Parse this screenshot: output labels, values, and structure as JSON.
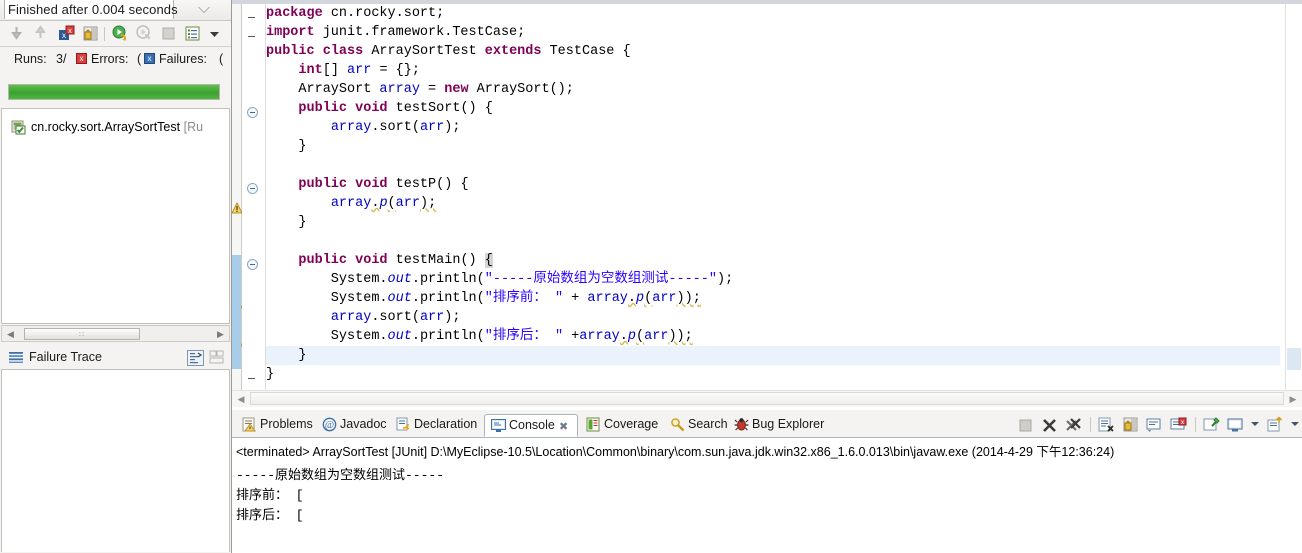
{
  "junit": {
    "title": "Finished after 0.004 seconds",
    "view_menu_icon": "chevron-down-icon",
    "toolbar": [
      {
        "name": "next-failure-icon",
        "glyph": "⇩"
      },
      {
        "name": "previous-failure-icon",
        "glyph": "⇧"
      },
      {
        "name": "show-failures-only-icon",
        "glyph": "x"
      },
      {
        "name": "scroll-lock-icon",
        "glyph": "ὑ2"
      },
      {
        "name": "rerun-test-icon",
        "glyph": "▶"
      },
      {
        "name": "rerun-test-failures-icon",
        "glyph": "▷"
      },
      {
        "name": "stop-test-run-icon",
        "glyph": "■"
      },
      {
        "name": "test-run-history-icon",
        "glyph": "☰"
      },
      {
        "name": "view-menu-icon",
        "glyph": "▾"
      }
    ],
    "stats": {
      "runs_label": "Runs:",
      "runs_value": "3/",
      "errors_label": "Errors:",
      "errors_value": "(",
      "failures_label": "Failures:",
      "failures_value": "("
    },
    "progress": {
      "percent": 100,
      "color": "#3da12f"
    },
    "tree": {
      "items": [
        {
          "icon": "test-class-passed-icon",
          "label": "cn.rocky.sort.ArraySortTest",
          "suffix": "[Ru"
        }
      ]
    },
    "hscroll": {
      "left_arrow": "◀",
      "right_arrow": "▶",
      "thumb_grip": "∶∶"
    },
    "failure_trace": {
      "icon": "failure-trace-icon",
      "label": "Failure Trace",
      "buttons": [
        {
          "name": "compare-result-icon"
        },
        {
          "name": "failure-trace-view-menu-icon"
        }
      ]
    }
  },
  "editor": {
    "code_lines": [
      {
        "fold": null,
        "dash": true,
        "warn": false,
        "changed": false,
        "current": false,
        "tokens": [
          {
            "t": "package",
            "c": "k"
          },
          {
            "t": " cn.rocky.sort;",
            "c": "m"
          }
        ]
      },
      {
        "fold": null,
        "dash": true,
        "warn": false,
        "changed": false,
        "current": false,
        "tokens": [
          {
            "t": "import",
            "c": "k"
          },
          {
            "t": " junit.framework.TestCase;",
            "c": "m"
          }
        ]
      },
      {
        "fold": null,
        "dash": false,
        "warn": false,
        "changed": false,
        "current": false,
        "tokens": [
          {
            "t": "public",
            "c": "k"
          },
          {
            "t": " ",
            "c": "m"
          },
          {
            "t": "class",
            "c": "k"
          },
          {
            "t": " ArraySortTest ",
            "c": "m"
          },
          {
            "t": "extends",
            "c": "k"
          },
          {
            "t": " TestCase {",
            "c": "m"
          }
        ]
      },
      {
        "fold": null,
        "dash": false,
        "warn": false,
        "changed": false,
        "current": false,
        "tokens": [
          {
            "t": "    ",
            "c": "m"
          },
          {
            "t": "int",
            "c": "k"
          },
          {
            "t": "[] ",
            "c": "m"
          },
          {
            "t": "arr",
            "c": "f"
          },
          {
            "t": " = {};",
            "c": "m"
          }
        ]
      },
      {
        "fold": null,
        "dash": false,
        "warn": false,
        "changed": false,
        "current": false,
        "tokens": [
          {
            "t": "    ArraySort ",
            "c": "m"
          },
          {
            "t": "array",
            "c": "f"
          },
          {
            "t": " = ",
            "c": "m"
          },
          {
            "t": "new",
            "c": "k"
          },
          {
            "t": " ArraySort();",
            "c": "m"
          }
        ]
      },
      {
        "fold": "collapse",
        "dash": false,
        "warn": false,
        "changed": false,
        "current": false,
        "tokens": [
          {
            "t": "    ",
            "c": "m"
          },
          {
            "t": "public",
            "c": "k"
          },
          {
            "t": " ",
            "c": "m"
          },
          {
            "t": "void",
            "c": "k"
          },
          {
            "t": " testSort() {",
            "c": "m"
          }
        ]
      },
      {
        "fold": null,
        "dash": false,
        "warn": false,
        "changed": false,
        "current": false,
        "tokens": [
          {
            "t": "        ",
            "c": "m"
          },
          {
            "t": "array",
            "c": "f"
          },
          {
            "t": ".sort(",
            "c": "m"
          },
          {
            "t": "arr",
            "c": "f"
          },
          {
            "t": ");",
            "c": "m"
          }
        ]
      },
      {
        "fold": null,
        "dash": false,
        "warn": false,
        "changed": false,
        "current": false,
        "tokens": [
          {
            "t": "    }",
            "c": "m"
          }
        ]
      },
      {
        "fold": null,
        "dash": false,
        "warn": false,
        "changed": false,
        "current": false,
        "tokens": []
      },
      {
        "fold": "collapse",
        "dash": false,
        "warn": false,
        "changed": false,
        "current": false,
        "tokens": [
          {
            "t": "    ",
            "c": "m"
          },
          {
            "t": "public",
            "c": "k"
          },
          {
            "t": " ",
            "c": "m"
          },
          {
            "t": "void",
            "c": "k"
          },
          {
            "t": " testP() {",
            "c": "m"
          }
        ]
      },
      {
        "fold": null,
        "dash": false,
        "warn": true,
        "changed": false,
        "current": false,
        "tokens": [
          {
            "t": "        ",
            "c": "m"
          },
          {
            "t": "array",
            "c": "f"
          },
          {
            "t": ".",
            "c": "mu"
          },
          {
            "t": "p",
            "c": "fi"
          },
          {
            "t": "(",
            "c": "mu"
          },
          {
            "t": "arr",
            "c": "f"
          },
          {
            "t": ");",
            "c": "mu"
          }
        ]
      },
      {
        "fold": null,
        "dash": false,
        "warn": false,
        "changed": false,
        "current": false,
        "tokens": [
          {
            "t": "    }",
            "c": "m"
          }
        ]
      },
      {
        "fold": null,
        "dash": false,
        "warn": false,
        "changed": false,
        "current": false,
        "tokens": []
      },
      {
        "fold": "collapse",
        "dash": false,
        "warn": false,
        "changed": true,
        "current": false,
        "tokens": [
          {
            "t": "    ",
            "c": "m"
          },
          {
            "t": "public",
            "c": "k"
          },
          {
            "t": " ",
            "c": "m"
          },
          {
            "t": "void",
            "c": "k"
          },
          {
            "t": " testMain() ",
            "c": "m"
          },
          {
            "t": "{",
            "c": "sel-brace"
          }
        ]
      },
      {
        "fold": null,
        "dash": false,
        "warn": false,
        "changed": true,
        "current": false,
        "tokens": [
          {
            "t": "        System.",
            "c": "m"
          },
          {
            "t": "out",
            "c": "fi"
          },
          {
            "t": ".println(",
            "c": "m"
          },
          {
            "t": "\"-----原始数组为空数组测试-----\"",
            "c": "s"
          },
          {
            "t": ");",
            "c": "m"
          }
        ]
      },
      {
        "fold": null,
        "dash": false,
        "warn": true,
        "changed": true,
        "current": false,
        "tokens": [
          {
            "t": "        System.",
            "c": "m"
          },
          {
            "t": "out",
            "c": "fi"
          },
          {
            "t": ".println(",
            "c": "m"
          },
          {
            "t": "\"排序前： \"",
            "c": "s"
          },
          {
            "t": " + ",
            "c": "m"
          },
          {
            "t": "array",
            "c": "f"
          },
          {
            "t": ".",
            "c": "mu"
          },
          {
            "t": "p",
            "c": "fi"
          },
          {
            "t": "(",
            "c": "mu"
          },
          {
            "t": "arr",
            "c": "f"
          },
          {
            "t": "));",
            "c": "mu"
          }
        ]
      },
      {
        "fold": null,
        "dash": false,
        "warn": false,
        "changed": true,
        "current": false,
        "tokens": [
          {
            "t": "        ",
            "c": "m"
          },
          {
            "t": "array",
            "c": "f"
          },
          {
            "t": ".sort(",
            "c": "m"
          },
          {
            "t": "arr",
            "c": "f"
          },
          {
            "t": ");",
            "c": "m"
          }
        ]
      },
      {
        "fold": null,
        "dash": false,
        "warn": true,
        "changed": true,
        "current": false,
        "tokens": [
          {
            "t": "        System.",
            "c": "m"
          },
          {
            "t": "out",
            "c": "fi"
          },
          {
            "t": ".println(",
            "c": "m"
          },
          {
            "t": "\"排序后： \"",
            "c": "s"
          },
          {
            "t": " +",
            "c": "m"
          },
          {
            "t": "array",
            "c": "f"
          },
          {
            "t": ".",
            "c": "mu"
          },
          {
            "t": "p",
            "c": "fi"
          },
          {
            "t": "(",
            "c": "mu"
          },
          {
            "t": "arr",
            "c": "f"
          },
          {
            "t": "));",
            "c": "mu"
          }
        ]
      },
      {
        "fold": null,
        "dash": false,
        "warn": false,
        "changed": true,
        "current": true,
        "tokens": [
          {
            "t": "    }",
            "c": "m"
          }
        ]
      },
      {
        "fold": null,
        "dash": true,
        "warn": false,
        "changed": false,
        "current": false,
        "tokens": [
          {
            "t": "}",
            "c": "m"
          }
        ]
      }
    ],
    "hscroll": {
      "left_arrow": "◀",
      "right_arrow": "▶"
    }
  },
  "console": {
    "tabs": [
      {
        "label": "Problems",
        "icon": "problems-icon",
        "active": false,
        "closeable": false
      },
      {
        "label": "Javadoc",
        "icon": "javadoc-icon",
        "active": false,
        "closeable": false
      },
      {
        "label": "Declaration",
        "icon": "declaration-icon",
        "active": false,
        "closeable": false
      },
      {
        "label": "Console",
        "icon": "console-icon",
        "active": true,
        "closeable": true
      },
      {
        "label": "Coverage",
        "icon": "coverage-icon",
        "active": false,
        "closeable": false
      },
      {
        "label": "Search",
        "icon": "search-icon",
        "active": false,
        "closeable": false
      },
      {
        "label": "Bug Explorer",
        "icon": "bug-explorer-icon",
        "active": false,
        "closeable": false
      }
    ],
    "toolbar": [
      {
        "name": "terminate-icon"
      },
      {
        "name": "remove-launch-icon"
      },
      {
        "name": "remove-all-terminated-launches-icon"
      },
      {
        "name": "clear-console-icon"
      },
      {
        "name": "scroll-lock-icon"
      },
      {
        "name": "word-wrap-icon"
      },
      {
        "name": "show-console-when-output-changes-icon"
      },
      {
        "name": "pin-console-icon"
      },
      {
        "name": "display-selected-console-icon"
      },
      {
        "name": "display-selected-console-caret-icon"
      },
      {
        "name": "open-console-icon"
      },
      {
        "name": "open-console-caret-icon"
      },
      {
        "name": "view-menu-icon"
      }
    ],
    "terminated_line": "<terminated> ArraySortTest [JUnit] D:\\MyEclipse-10.5\\Location\\Common\\binary\\com.sun.java.jdk.win32.x86_1.6.0.013\\bin\\javaw.exe (2014-4-29 下午12:36:24)",
    "output_lines": [
      "-----原始数组为空数组测试-----",
      "排序前：  [",
      "排序后：  ["
    ]
  }
}
